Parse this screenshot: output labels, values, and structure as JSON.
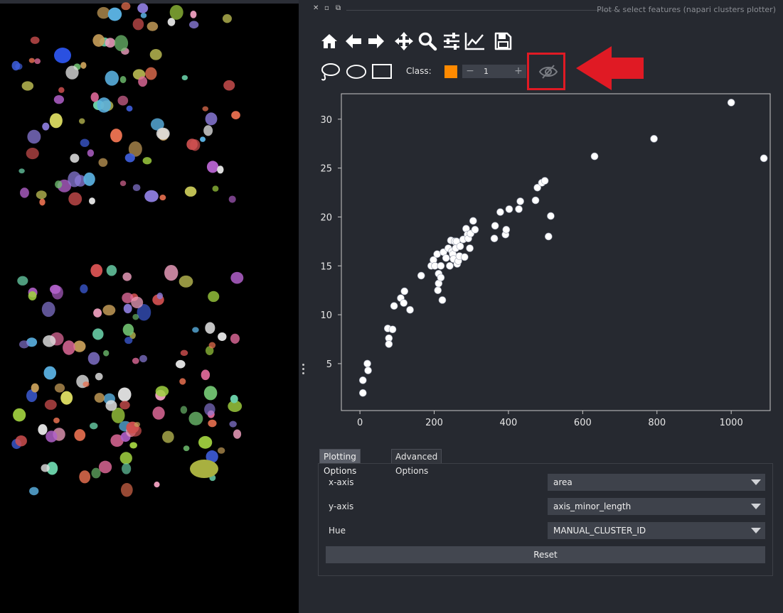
{
  "window": {
    "title": "Plot & select features (napari clusters plotter)",
    "buttons": [
      "close-icon",
      "float-icon",
      "maximize-icon"
    ]
  },
  "toolbar": {
    "navigation": [
      "home-icon",
      "back-arrow-icon",
      "forward-arrow-icon",
      "pan-move-icon",
      "zoom-magnifier-icon",
      "subplot-settings-icon",
      "line-chart-icon",
      "save-disk-icon"
    ],
    "selection": [
      "lasso-icon",
      "ellipse-icon",
      "rectangle-icon"
    ],
    "class_label": "Class:",
    "class_color": "#ff8a00",
    "class_minus": "−",
    "class_value": "1",
    "class_plus": "+",
    "visibility_icon": "eye-slash-icon"
  },
  "annotation": {
    "highlight_color": "#e01a24",
    "arrow": "red-arrow-pointing-left"
  },
  "chart_data": {
    "type": "scatter",
    "xlim": [
      -50,
      1105
    ],
    "ylim": [
      0.2,
      32.6
    ],
    "xticks": [
      0,
      200,
      400,
      600,
      800,
      1000
    ],
    "yticks": [
      5,
      10,
      15,
      20,
      25,
      30
    ],
    "xlabel": "",
    "ylabel": "",
    "grid": false,
    "point_color": "#ffffff",
    "points": [
      [
        8,
        2
      ],
      [
        8,
        3.3
      ],
      [
        20,
        5
      ],
      [
        22,
        4.3
      ],
      [
        75,
        8.6
      ],
      [
        78,
        7.6
      ],
      [
        78,
        7
      ],
      [
        88,
        8.5
      ],
      [
        92,
        10.9
      ],
      [
        110,
        11.7
      ],
      [
        118,
        11.2
      ],
      [
        120,
        12.4
      ],
      [
        135,
        10.5
      ],
      [
        165,
        14
      ],
      [
        192,
        15
      ],
      [
        198,
        15.6
      ],
      [
        202,
        15
      ],
      [
        208,
        16.2
      ],
      [
        210,
        12.5
      ],
      [
        212,
        13.2
      ],
      [
        212,
        14.2
      ],
      [
        218,
        13.8
      ],
      [
        222,
        11.5
      ],
      [
        218,
        15
      ],
      [
        225,
        16.4
      ],
      [
        232,
        15.8
      ],
      [
        238,
        16.8
      ],
      [
        242,
        15
      ],
      [
        245,
        17.6
      ],
      [
        248,
        16.5
      ],
      [
        250,
        16.2
      ],
      [
        252,
        15.7
      ],
      [
        255,
        17.5
      ],
      [
        258,
        16.8
      ],
      [
        260,
        17.5
      ],
      [
        262,
        15.2
      ],
      [
        265,
        15.5
      ],
      [
        268,
        16
      ],
      [
        270,
        17
      ],
      [
        278,
        17.7
      ],
      [
        282,
        15.9
      ],
      [
        286,
        18.8
      ],
      [
        290,
        18.2
      ],
      [
        292,
        17.8
      ],
      [
        296,
        16.8
      ],
      [
        298,
        18.3
      ],
      [
        305,
        19.6
      ],
      [
        310,
        18.7
      ],
      [
        362,
        17.8
      ],
      [
        364,
        19.1
      ],
      [
        378,
        20.5
      ],
      [
        392,
        18.2
      ],
      [
        394,
        18.7
      ],
      [
        402,
        20.8
      ],
      [
        428,
        20.8
      ],
      [
        432,
        21.6
      ],
      [
        473,
        21.7
      ],
      [
        478,
        23
      ],
      [
        490,
        23.5
      ],
      [
        498,
        23.7
      ],
      [
        508,
        18
      ],
      [
        514,
        20.1
      ],
      [
        632,
        26.2
      ],
      [
        792,
        28
      ],
      [
        1000,
        31.7
      ],
      [
        1088,
        26
      ]
    ]
  },
  "tabs": [
    "Plotting Options",
    "Advanced Options"
  ],
  "options": {
    "x_axis_label": "x-axis",
    "x_axis_value": "area",
    "y_axis_label": "y-axis",
    "y_axis_value": "axis_minor_length",
    "hue_label": "Hue",
    "hue_value": "MANUAL_CLUSTER_ID",
    "reset_label": "Reset"
  }
}
